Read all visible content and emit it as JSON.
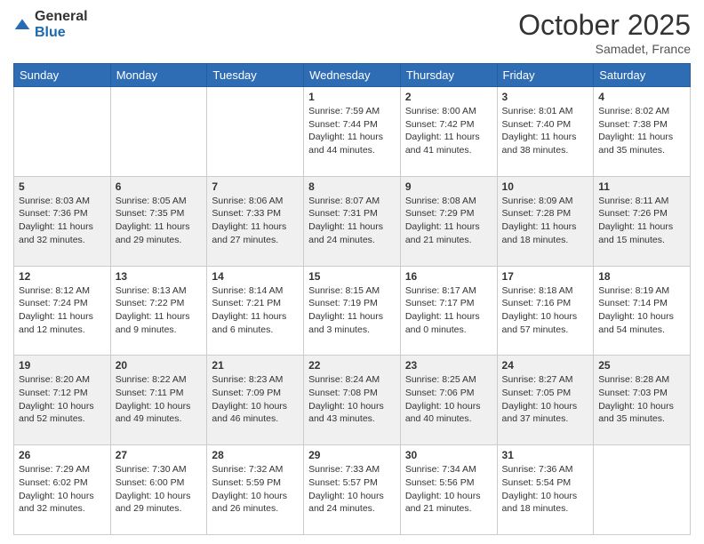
{
  "header": {
    "logo": {
      "general": "General",
      "blue": "Blue"
    },
    "title": "October 2025",
    "location": "Samadet, France"
  },
  "days_of_week": [
    "Sunday",
    "Monday",
    "Tuesday",
    "Wednesday",
    "Thursday",
    "Friday",
    "Saturday"
  ],
  "weeks": [
    {
      "days": [
        {
          "num": "",
          "info": ""
        },
        {
          "num": "",
          "info": ""
        },
        {
          "num": "",
          "info": ""
        },
        {
          "num": "1",
          "info": "Sunrise: 7:59 AM\nSunset: 7:44 PM\nDaylight: 11 hours\nand 44 minutes."
        },
        {
          "num": "2",
          "info": "Sunrise: 8:00 AM\nSunset: 7:42 PM\nDaylight: 11 hours\nand 41 minutes."
        },
        {
          "num": "3",
          "info": "Sunrise: 8:01 AM\nSunset: 7:40 PM\nDaylight: 11 hours\nand 38 minutes."
        },
        {
          "num": "4",
          "info": "Sunrise: 8:02 AM\nSunset: 7:38 PM\nDaylight: 11 hours\nand 35 minutes."
        }
      ]
    },
    {
      "days": [
        {
          "num": "5",
          "info": "Sunrise: 8:03 AM\nSunset: 7:36 PM\nDaylight: 11 hours\nand 32 minutes."
        },
        {
          "num": "6",
          "info": "Sunrise: 8:05 AM\nSunset: 7:35 PM\nDaylight: 11 hours\nand 29 minutes."
        },
        {
          "num": "7",
          "info": "Sunrise: 8:06 AM\nSunset: 7:33 PM\nDaylight: 11 hours\nand 27 minutes."
        },
        {
          "num": "8",
          "info": "Sunrise: 8:07 AM\nSunset: 7:31 PM\nDaylight: 11 hours\nand 24 minutes."
        },
        {
          "num": "9",
          "info": "Sunrise: 8:08 AM\nSunset: 7:29 PM\nDaylight: 11 hours\nand 21 minutes."
        },
        {
          "num": "10",
          "info": "Sunrise: 8:09 AM\nSunset: 7:28 PM\nDaylight: 11 hours\nand 18 minutes."
        },
        {
          "num": "11",
          "info": "Sunrise: 8:11 AM\nSunset: 7:26 PM\nDaylight: 11 hours\nand 15 minutes."
        }
      ]
    },
    {
      "days": [
        {
          "num": "12",
          "info": "Sunrise: 8:12 AM\nSunset: 7:24 PM\nDaylight: 11 hours\nand 12 minutes."
        },
        {
          "num": "13",
          "info": "Sunrise: 8:13 AM\nSunset: 7:22 PM\nDaylight: 11 hours\nand 9 minutes."
        },
        {
          "num": "14",
          "info": "Sunrise: 8:14 AM\nSunset: 7:21 PM\nDaylight: 11 hours\nand 6 minutes."
        },
        {
          "num": "15",
          "info": "Sunrise: 8:15 AM\nSunset: 7:19 PM\nDaylight: 11 hours\nand 3 minutes."
        },
        {
          "num": "16",
          "info": "Sunrise: 8:17 AM\nSunset: 7:17 PM\nDaylight: 11 hours\nand 0 minutes."
        },
        {
          "num": "17",
          "info": "Sunrise: 8:18 AM\nSunset: 7:16 PM\nDaylight: 10 hours\nand 57 minutes."
        },
        {
          "num": "18",
          "info": "Sunrise: 8:19 AM\nSunset: 7:14 PM\nDaylight: 10 hours\nand 54 minutes."
        }
      ]
    },
    {
      "days": [
        {
          "num": "19",
          "info": "Sunrise: 8:20 AM\nSunset: 7:12 PM\nDaylight: 10 hours\nand 52 minutes."
        },
        {
          "num": "20",
          "info": "Sunrise: 8:22 AM\nSunset: 7:11 PM\nDaylight: 10 hours\nand 49 minutes."
        },
        {
          "num": "21",
          "info": "Sunrise: 8:23 AM\nSunset: 7:09 PM\nDaylight: 10 hours\nand 46 minutes."
        },
        {
          "num": "22",
          "info": "Sunrise: 8:24 AM\nSunset: 7:08 PM\nDaylight: 10 hours\nand 43 minutes."
        },
        {
          "num": "23",
          "info": "Sunrise: 8:25 AM\nSunset: 7:06 PM\nDaylight: 10 hours\nand 40 minutes."
        },
        {
          "num": "24",
          "info": "Sunrise: 8:27 AM\nSunset: 7:05 PM\nDaylight: 10 hours\nand 37 minutes."
        },
        {
          "num": "25",
          "info": "Sunrise: 8:28 AM\nSunset: 7:03 PM\nDaylight: 10 hours\nand 35 minutes."
        }
      ]
    },
    {
      "days": [
        {
          "num": "26",
          "info": "Sunrise: 7:29 AM\nSunset: 6:02 PM\nDaylight: 10 hours\nand 32 minutes."
        },
        {
          "num": "27",
          "info": "Sunrise: 7:30 AM\nSunset: 6:00 PM\nDaylight: 10 hours\nand 29 minutes."
        },
        {
          "num": "28",
          "info": "Sunrise: 7:32 AM\nSunset: 5:59 PM\nDaylight: 10 hours\nand 26 minutes."
        },
        {
          "num": "29",
          "info": "Sunrise: 7:33 AM\nSunset: 5:57 PM\nDaylight: 10 hours\nand 24 minutes."
        },
        {
          "num": "30",
          "info": "Sunrise: 7:34 AM\nSunset: 5:56 PM\nDaylight: 10 hours\nand 21 minutes."
        },
        {
          "num": "31",
          "info": "Sunrise: 7:36 AM\nSunset: 5:54 PM\nDaylight: 10 hours\nand 18 minutes."
        },
        {
          "num": "",
          "info": ""
        }
      ]
    }
  ]
}
